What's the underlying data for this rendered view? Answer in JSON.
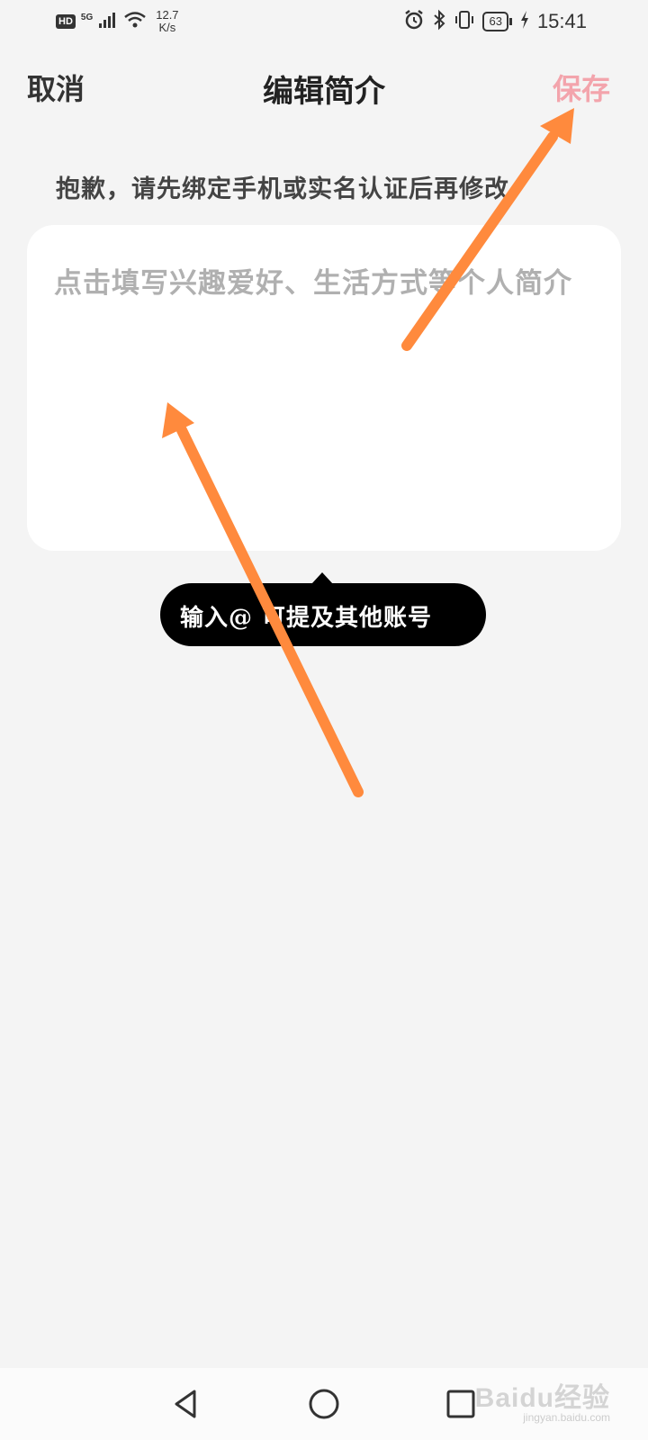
{
  "status_bar": {
    "hd": "HD",
    "network": "5G",
    "speed_value": "12.7",
    "speed_unit": "K/s",
    "battery": "63",
    "time": "15:41",
    "icons": [
      "signal-icon",
      "wifi-icon",
      "alarm-icon",
      "bluetooth-icon",
      "vibrate-icon",
      "battery-icon",
      "charging-icon"
    ]
  },
  "header": {
    "cancel": "取消",
    "title": "编辑简介",
    "save": "保存",
    "save_color": "#f3a4ac"
  },
  "notice": "抱歉，请先绑定手机或实名认证后再修改",
  "bio": {
    "placeholder": "点击填写兴趣爱好、生活方式等个人简介"
  },
  "tooltip": "输入@ 可提及其他账号",
  "annotation": {
    "arrow_color": "#ff8a3d"
  },
  "watermark": {
    "main": "Baidu经验",
    "sub": "jingyan.baidu.com"
  }
}
